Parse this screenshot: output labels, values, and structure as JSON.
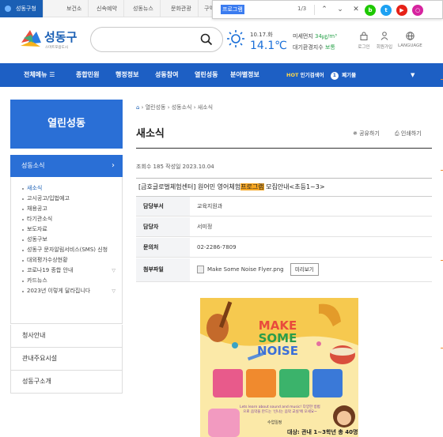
{
  "top_tabs": [
    "성동구청",
    "보건소",
    "신속예약",
    "성동뉴스",
    "문화관광",
    "구역"
  ],
  "find": {
    "term": "프로그램",
    "count": "1/3"
  },
  "header": {
    "logo_text": "성동구",
    "logo_sub": "스마트포용도시",
    "search_placeholder": "",
    "date": "10.17.화",
    "temp": "14.1℃",
    "air_label1": "미세먼지",
    "air_value1": "34㎍/m³",
    "air_label2": "대기환경지수",
    "air_value2": "보통",
    "icons": [
      {
        "name": "login",
        "label": "로그인"
      },
      {
        "name": "register",
        "label": "회원가입"
      },
      {
        "name": "language",
        "label": "LANGUAGE"
      }
    ]
  },
  "nav": {
    "all_menu": "전체메뉴",
    "items": [
      "종합민원",
      "행정정보",
      "성동참여",
      "열린성동",
      "분야별정보"
    ],
    "hot_label": "HOT",
    "hot_text": "인기검색어",
    "hot_rank": "1",
    "hot_word": "폐기물"
  },
  "sidebar": {
    "title": "열린성동",
    "selected": "성동소식",
    "sub_items": [
      "새소식",
      "고시공고/입법예고",
      "채용공고",
      "타기관소식",
      "보도자료",
      "성동구보",
      "성동구 문자알림서비스(SMS) 신청",
      "대외평가수상현황",
      "코로나19 종합 안내",
      "카드뉴스",
      "2023년 이렇게 달라집니다"
    ],
    "other_items": [
      "청사안내",
      "관내주요시설",
      "성동구소개"
    ]
  },
  "content": {
    "breadcrumb": [
      "열린성동",
      "성동소식",
      "새소식"
    ],
    "title": "새소식",
    "share": "공유하기",
    "print": "인쇄하기",
    "meta": "조회수 185 작성일 2023.10.04",
    "post_title_pre": "[금호글로벌체험센터] 원어민 영어체험",
    "post_title_hl": "프로그램",
    "post_title_post": " 모집안내<초등1~3>",
    "rows": [
      {
        "key": "담당부서",
        "value": "교육지원과"
      },
      {
        "key": "담당자",
        "value": "서미정"
      },
      {
        "key": "문의처",
        "value": "02-2286-7809"
      }
    ],
    "attach_key": "첨부파일",
    "attach_file": "Make Some Noise Flyer.png",
    "preview_btn": "미리보기"
  },
  "flyer": {
    "title_lines": [
      "MAKE",
      "SOME",
      "NOISE"
    ],
    "tagline": "Lets learn about sound and music! 다양한 방법으로 음악을 만드는 '신나는 음악 교실'에 오세요~",
    "info_label": "수업일정",
    "target": "대상: 관내 1~3학년 총 40명"
  },
  "colors": {
    "brand": "#1d5fc4",
    "highlight": "#f5a623",
    "find_selection": "#3b7cf0"
  }
}
